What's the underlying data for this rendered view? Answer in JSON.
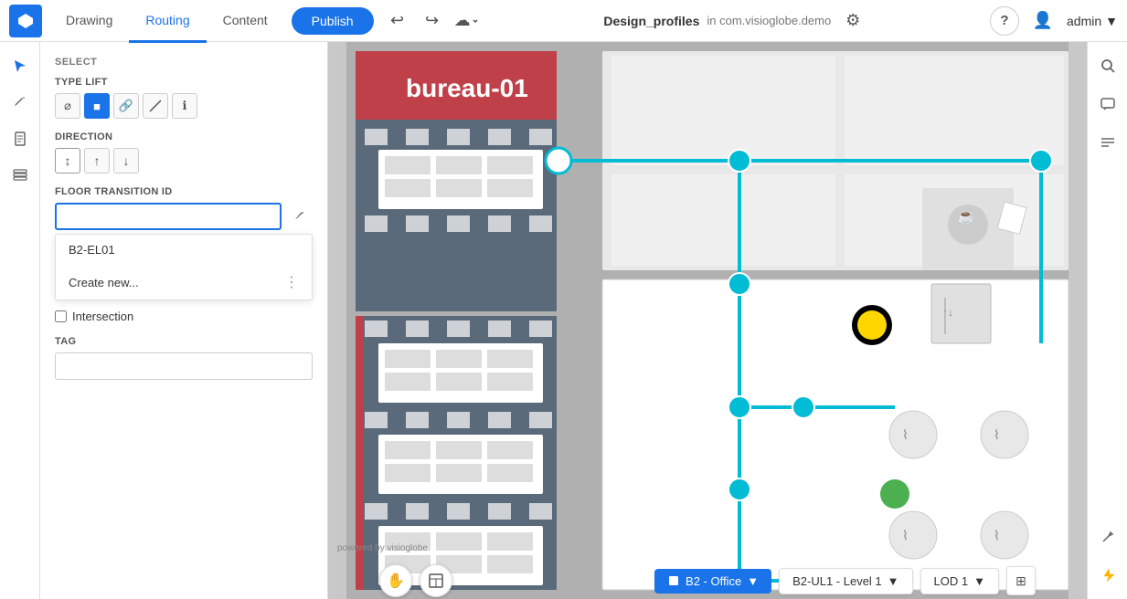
{
  "toolbar": {
    "tabs": [
      {
        "id": "drawing",
        "label": "Drawing",
        "active": false
      },
      {
        "id": "routing",
        "label": "Routing",
        "active": true
      },
      {
        "id": "content",
        "label": "Content",
        "active": false
      }
    ],
    "publish_label": "Publish",
    "undo_icon": "↩",
    "redo_icon": "↪",
    "cloud_icon": "☁",
    "document_title": "Design_profiles",
    "document_context": "in com.visioglobe.demo",
    "settings_icon": "⚙",
    "help_icon": "?",
    "user_icon": "👤",
    "user_name": "admin"
  },
  "left_panel": {
    "icons": [
      {
        "id": "cursor",
        "symbol": "↖",
        "active": true
      },
      {
        "id": "pencil",
        "symbol": "✏"
      },
      {
        "id": "document",
        "symbol": "📄"
      },
      {
        "id": "layers",
        "symbol": "⊞"
      }
    ]
  },
  "sidebar": {
    "section_title": "SELECT",
    "type_lift": {
      "label": "TYPE LIFT",
      "buttons": [
        {
          "id": "none",
          "symbol": "⊘",
          "active": false
        },
        {
          "id": "lift",
          "symbol": "■",
          "active": true
        },
        {
          "id": "link",
          "symbol": "⛓",
          "active": false
        },
        {
          "id": "line",
          "symbol": "⟋",
          "active": false
        },
        {
          "id": "info",
          "symbol": "ℹ",
          "active": false
        }
      ]
    },
    "direction": {
      "label": "DIRECTION",
      "buttons": [
        {
          "id": "both",
          "symbol": "↕",
          "active": true
        },
        {
          "id": "up",
          "symbol": "↑",
          "active": false
        },
        {
          "id": "down",
          "symbol": "↓",
          "active": false
        }
      ]
    },
    "floor_transition": {
      "label": "FLOOR TRANSITION ID",
      "value": "",
      "placeholder": ""
    },
    "dropdown_items": [
      {
        "id": "B2-EL01",
        "label": "B2-EL01",
        "has_more": false
      },
      {
        "id": "create-new",
        "label": "Create new...",
        "has_more": true
      }
    ],
    "intersection": {
      "label": "Intersection",
      "checked": false
    },
    "tag": {
      "label": "TAG",
      "value": ""
    }
  },
  "map": {
    "building_label": "bureau-01",
    "building_color": "#c0404a"
  },
  "right_panel": {
    "icons": [
      {
        "id": "search",
        "symbol": "🔍"
      },
      {
        "id": "chat",
        "symbol": "💬"
      },
      {
        "id": "list",
        "symbol": "≡"
      },
      {
        "id": "wrench",
        "symbol": "🔧"
      },
      {
        "id": "lightning",
        "symbol": "⚡"
      }
    ]
  },
  "bottom_bar": {
    "hand_icon": "✋",
    "building_icon": "🏢",
    "floor_label": "B2 - Office",
    "level_label": "B2-UL1 - Level 1",
    "lod_label": "LOD 1",
    "fullscreen_icon": "⛶"
  },
  "powered_by": "powered by visioglobe"
}
